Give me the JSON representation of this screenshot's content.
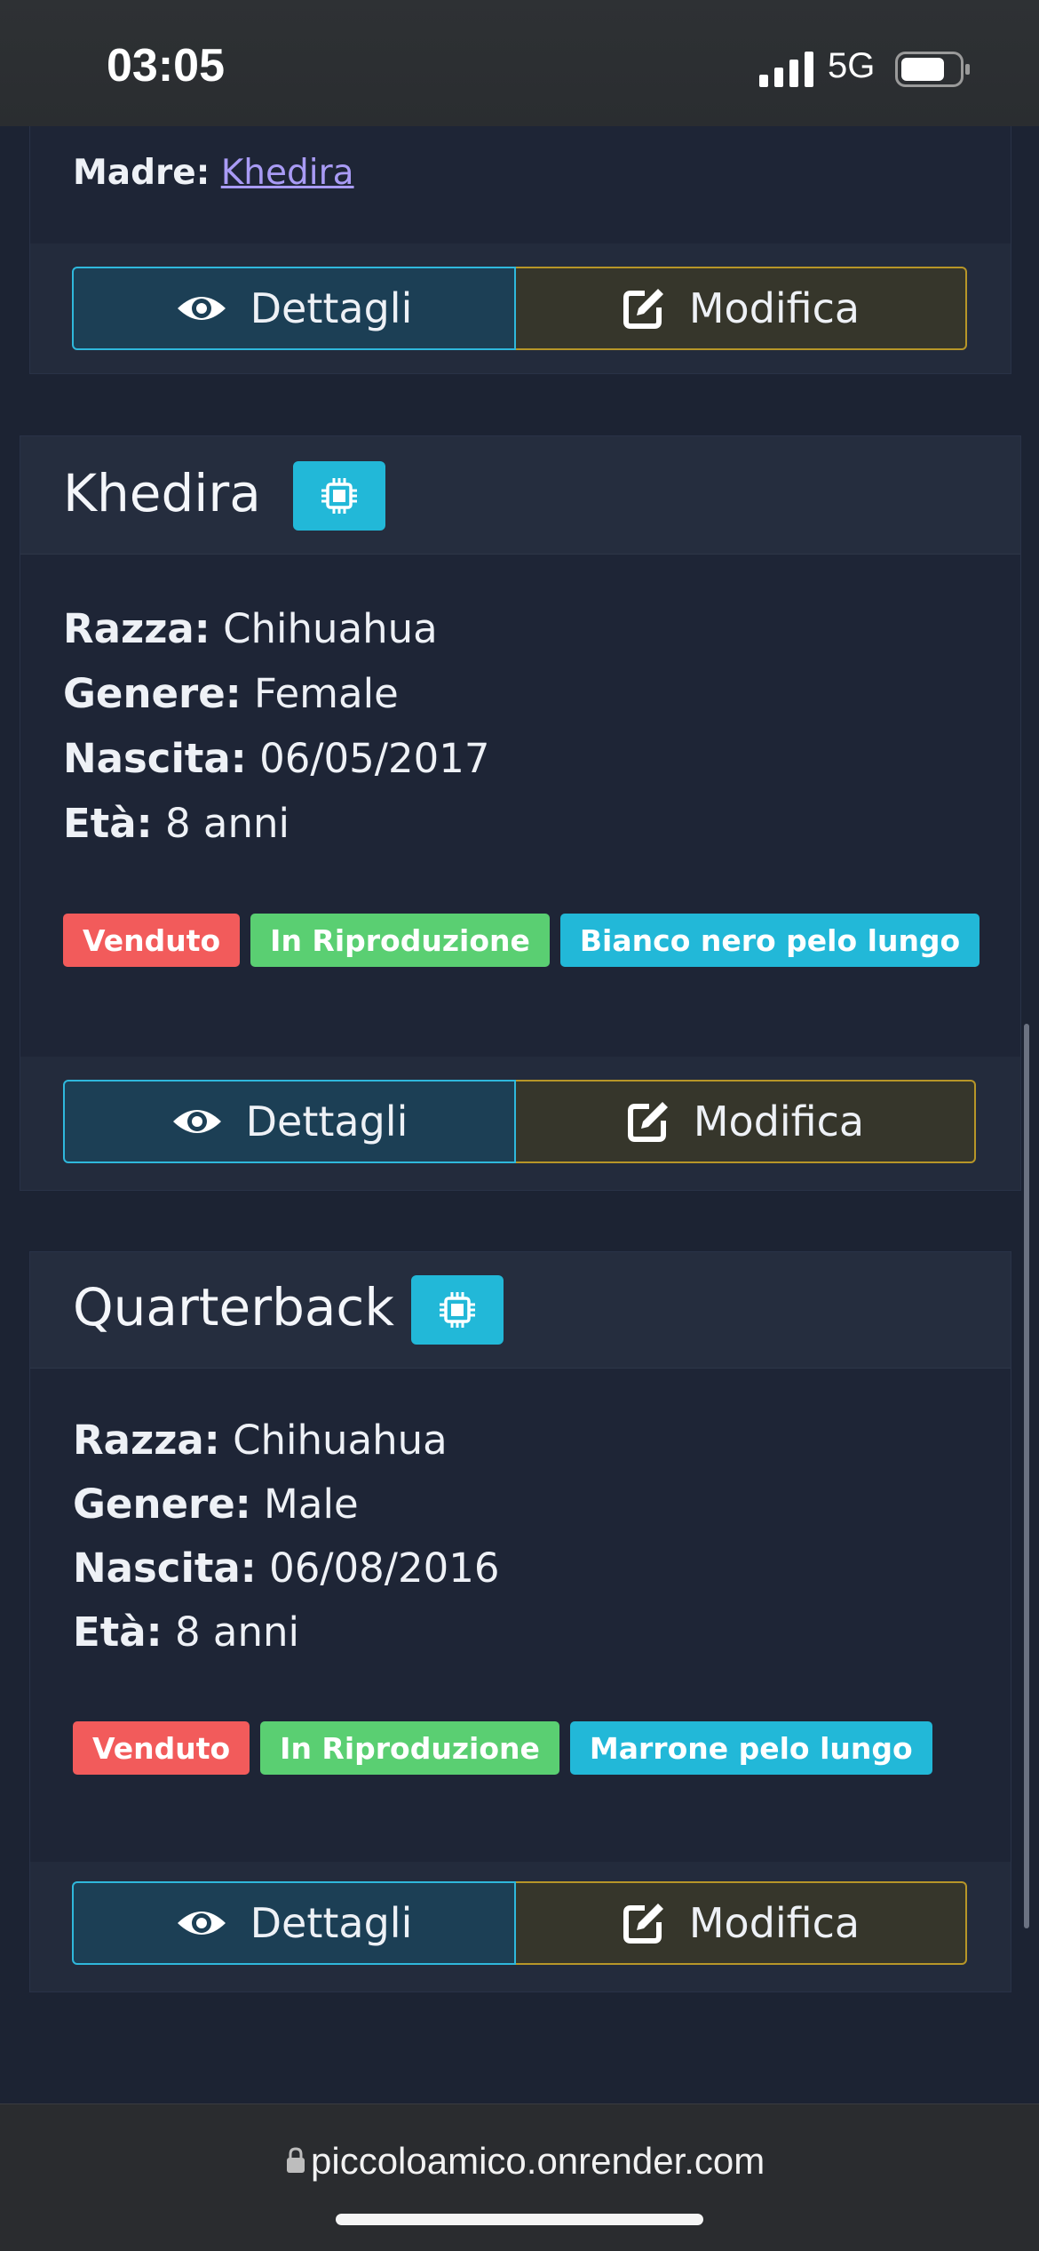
{
  "status_bar": {
    "time": "03:05",
    "network": "5G"
  },
  "previous_card": {
    "madre_label": "Madre:",
    "madre_value": "Khedira"
  },
  "buttons": {
    "details": "Dettagli",
    "edit": "Modifica"
  },
  "labels": {
    "breed": "Razza:",
    "gender": "Genere:",
    "birth": "Nascita:",
    "age": "Età:"
  },
  "dogs": [
    {
      "name": "Khedira",
      "breed": "Chihuahua",
      "gender": "Female",
      "birth": "06/05/2017",
      "age": "8 anni",
      "tags": [
        "Venduto",
        "In Riproduzione",
        "Bianco nero pelo lungo"
      ]
    },
    {
      "name": "Quarterback",
      "breed": "Chihuahua",
      "gender": "Male",
      "birth": "06/08/2016",
      "age": "8 anni",
      "tags": [
        "Venduto",
        "In Riproduzione",
        "Marrone pelo lungo"
      ]
    }
  ],
  "browser": {
    "url": "piccoloamico.onrender.com"
  },
  "colors": {
    "background": "#1c2333",
    "tag_sold": "#f25b5b",
    "tag_breeding": "#5acf72",
    "tag_color": "#22b8d8",
    "details_border": "#2fb8dc",
    "edit_border": "#b79628",
    "link": "#a99bf5"
  },
  "icons": [
    "eye-icon",
    "edit-icon",
    "microchip-icon",
    "lock-icon",
    "signal-icon",
    "battery-icon"
  ]
}
